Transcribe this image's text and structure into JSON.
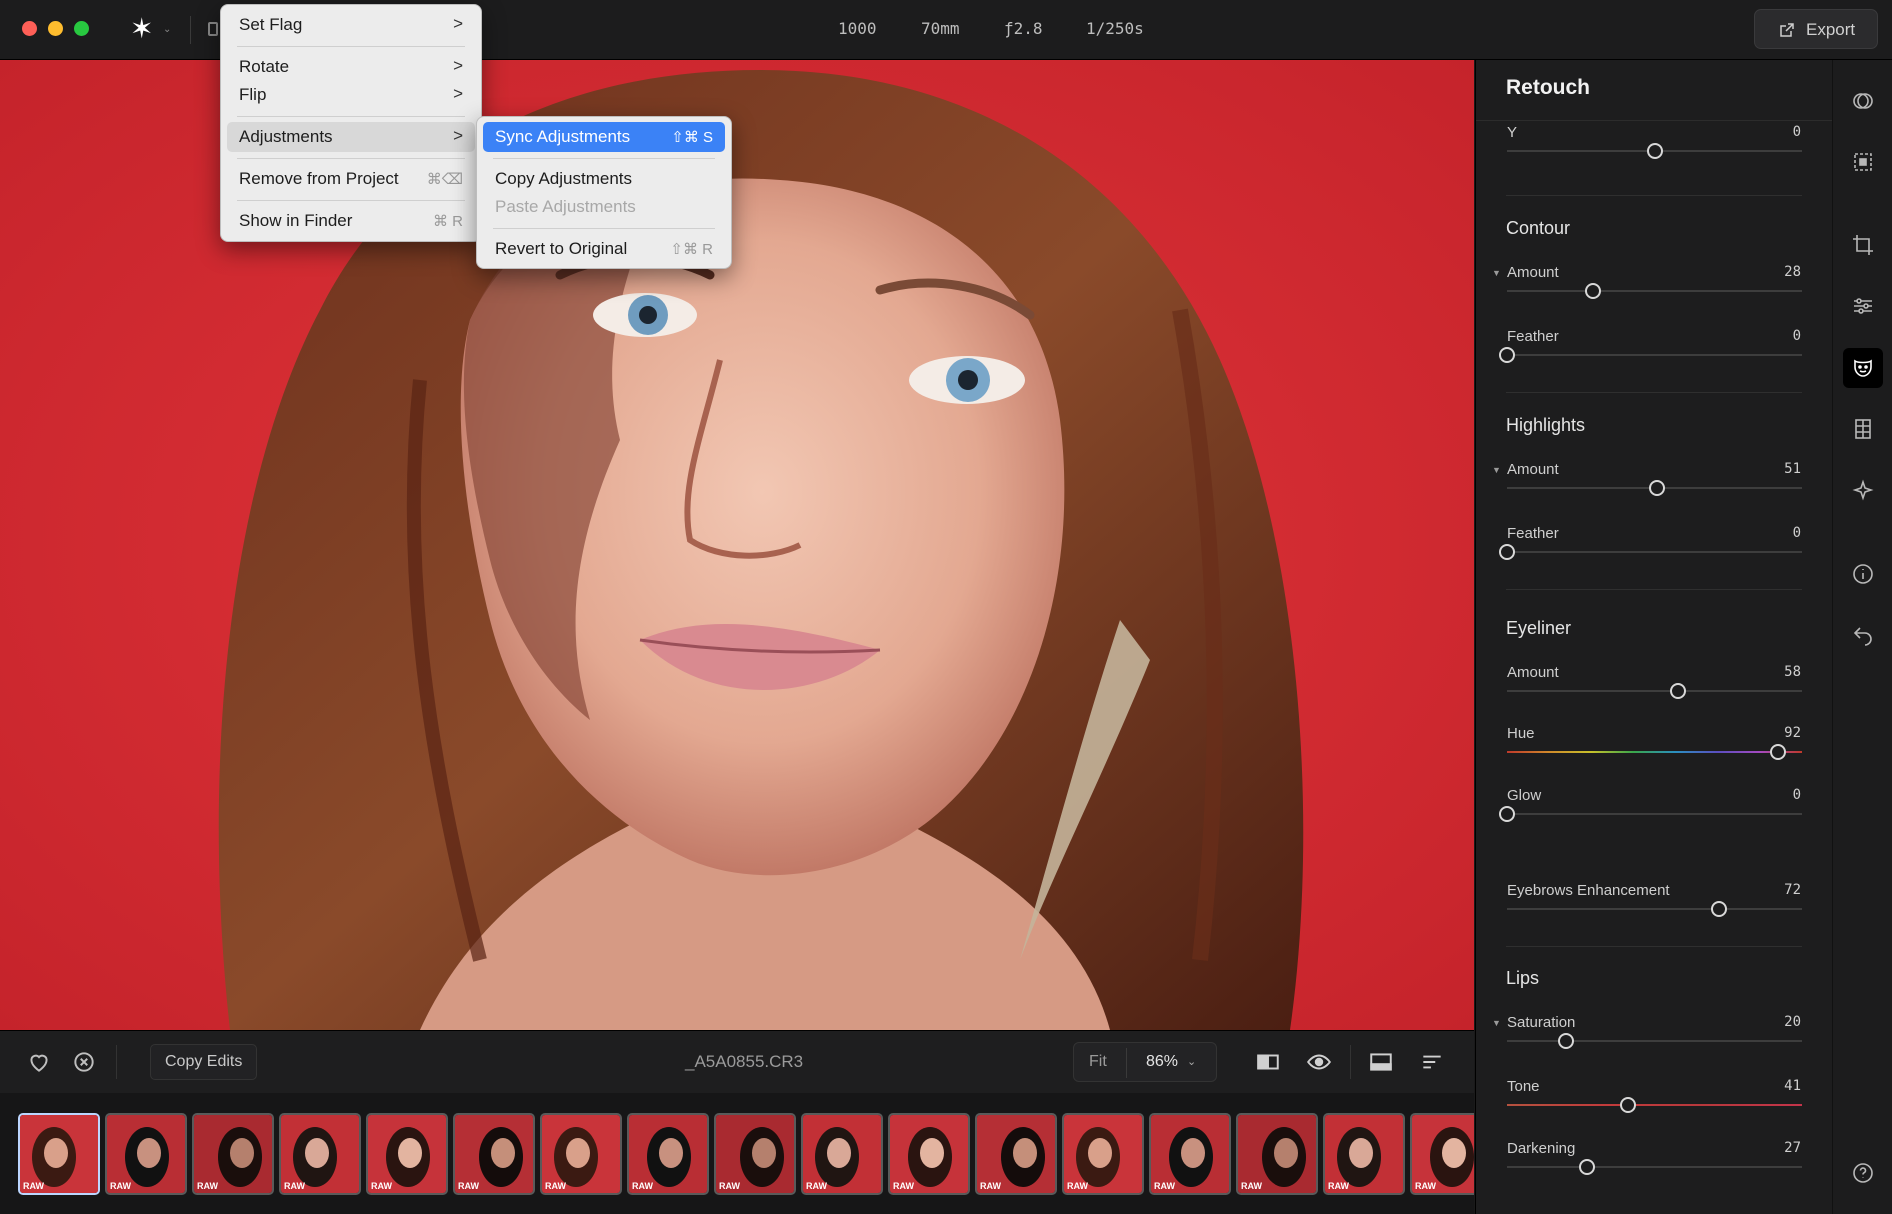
{
  "toolbar": {
    "meta": [
      "1000",
      "70mm",
      "ƒ2.8",
      "1/250s"
    ],
    "export_label": "Export"
  },
  "context_menu": {
    "items": [
      {
        "label": "Set Flag",
        "arrow": ">"
      },
      {
        "label": "Rotate",
        "arrow": ">"
      },
      {
        "label": "Flip",
        "arrow": ">"
      },
      {
        "label": "Adjustments",
        "arrow": ">"
      },
      {
        "label": "Remove from Project",
        "shortcut": "⌘⌫"
      },
      {
        "label": "Show in Finder",
        "shortcut": "⌘ R"
      }
    ]
  },
  "submenu": {
    "items": [
      {
        "label": "Sync Adjustments",
        "shortcut": "⇧⌘ S"
      },
      {
        "label": "Copy Adjustments",
        "shortcut": ""
      },
      {
        "label": "Paste Adjustments",
        "shortcut": ""
      },
      {
        "label": "Revert to Original",
        "shortcut": "⇧⌘ R"
      }
    ]
  },
  "bottom": {
    "copy_edits": "Copy Edits",
    "filename": "_A5A0855.CR3",
    "zoom_fit": "Fit",
    "zoom_value": "86%"
  },
  "filmstrip": {
    "badge": "RAW",
    "count": 17,
    "selected_index": 0
  },
  "panel": {
    "title": "Retouch",
    "y_row": {
      "label": "Y",
      "value": "0",
      "level": 0.5
    },
    "sections": [
      {
        "title": "Contour",
        "rows": [
          {
            "label": "Amount",
            "value": "28",
            "level": 0.29,
            "disclosure": true
          },
          {
            "label": "Feather",
            "value": "0",
            "level": 0.0
          }
        ]
      },
      {
        "title": "Highlights",
        "rows": [
          {
            "label": "Amount",
            "value": "51",
            "level": 0.51,
            "disclosure": true
          },
          {
            "label": "Feather",
            "value": "0",
            "level": 0.0
          }
        ]
      },
      {
        "title": "Eyeliner",
        "rows": [
          {
            "label": "Amount",
            "value": "58",
            "level": 0.58
          },
          {
            "label": "Hue",
            "value": "92",
            "level": 0.92
          },
          {
            "label": "Glow",
            "value": "0",
            "level": 0.0
          },
          {
            "label": "Eyebrows Enhancement",
            "value": "72",
            "level": 0.72
          }
        ]
      },
      {
        "title": "Lips",
        "rows": [
          {
            "label": "Saturation",
            "value": "20",
            "level": 0.2,
            "disclosure": true
          },
          {
            "label": "Tone",
            "value": "41",
            "level": 0.41
          },
          {
            "label": "Darkening",
            "value": "27",
            "level": 0.27
          }
        ]
      }
    ]
  },
  "icons": {
    "right_bar": [
      "presets-icon",
      "select-icon",
      "crop-icon",
      "adjustments-icon",
      "retouch-face-icon",
      "grid-icon",
      "magic-icon",
      "info-icon",
      "undo-icon",
      "help-icon"
    ]
  }
}
